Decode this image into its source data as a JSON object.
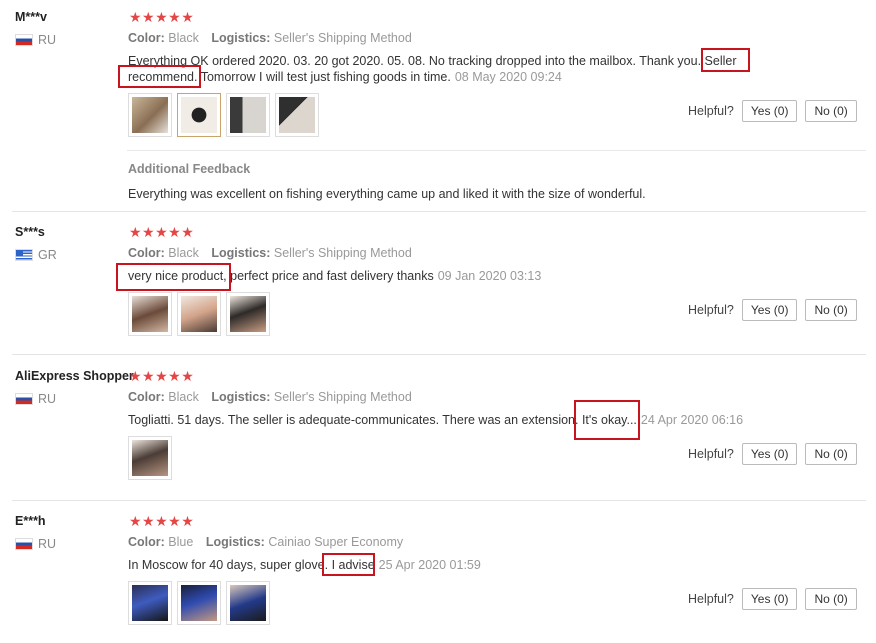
{
  "labels": {
    "color": "Color:",
    "logistics": "Logistics:",
    "helpful": "Helpful?",
    "yes": "Yes (0)",
    "no": "No (0)",
    "stars": "★★★★★",
    "additional_feedback": "Additional Feedback"
  },
  "colors": {
    "star": "#e64545",
    "highlight": "#c8141e"
  },
  "rating_stars": 5,
  "reviews": [
    {
      "name": "M***v",
      "country": "RU",
      "flag": "russia-flag-icon",
      "color": "Black",
      "logistics": "Seller's Shipping Method",
      "text": "Everything OK ordered 2020. 03. 20 got 2020. 05. 08. No tracking dropped into the mailbox. Thank you. Seller recommend. Tomorrow I will test just fishing goods in time.",
      "date": "08 May 2020 09:24",
      "photos": 4,
      "additional_feedback": "Everything was excellent on fishing everything came up and liked it with the size of wonderful."
    },
    {
      "name": "S***s",
      "country": "GR",
      "flag": "greece-flag-icon",
      "color": "Black",
      "logistics": "Seller's Shipping Method",
      "text": "very nice product, perfect price and fast delivery thanks",
      "date": "09 Jan 2020 03:13",
      "photos": 3
    },
    {
      "name": "AliExpress Shopper",
      "country": "RU",
      "flag": "russia-flag-icon",
      "color": "Black",
      "logistics": "Seller's Shipping Method",
      "text": "Togliatti. 51 days. The seller is adequate-communicates. There was an extension. It's okay...",
      "date": "24 Apr 2020 06:16",
      "photos": 1
    },
    {
      "name": "E***h",
      "country": "RU",
      "flag": "russia-flag-icon",
      "color": "Blue",
      "logistics": "Cainiao Super Economy",
      "text": "In Moscow for 40 days, super glove. I advise",
      "date": "25 Apr 2020 01:59",
      "photos": 3
    }
  ]
}
